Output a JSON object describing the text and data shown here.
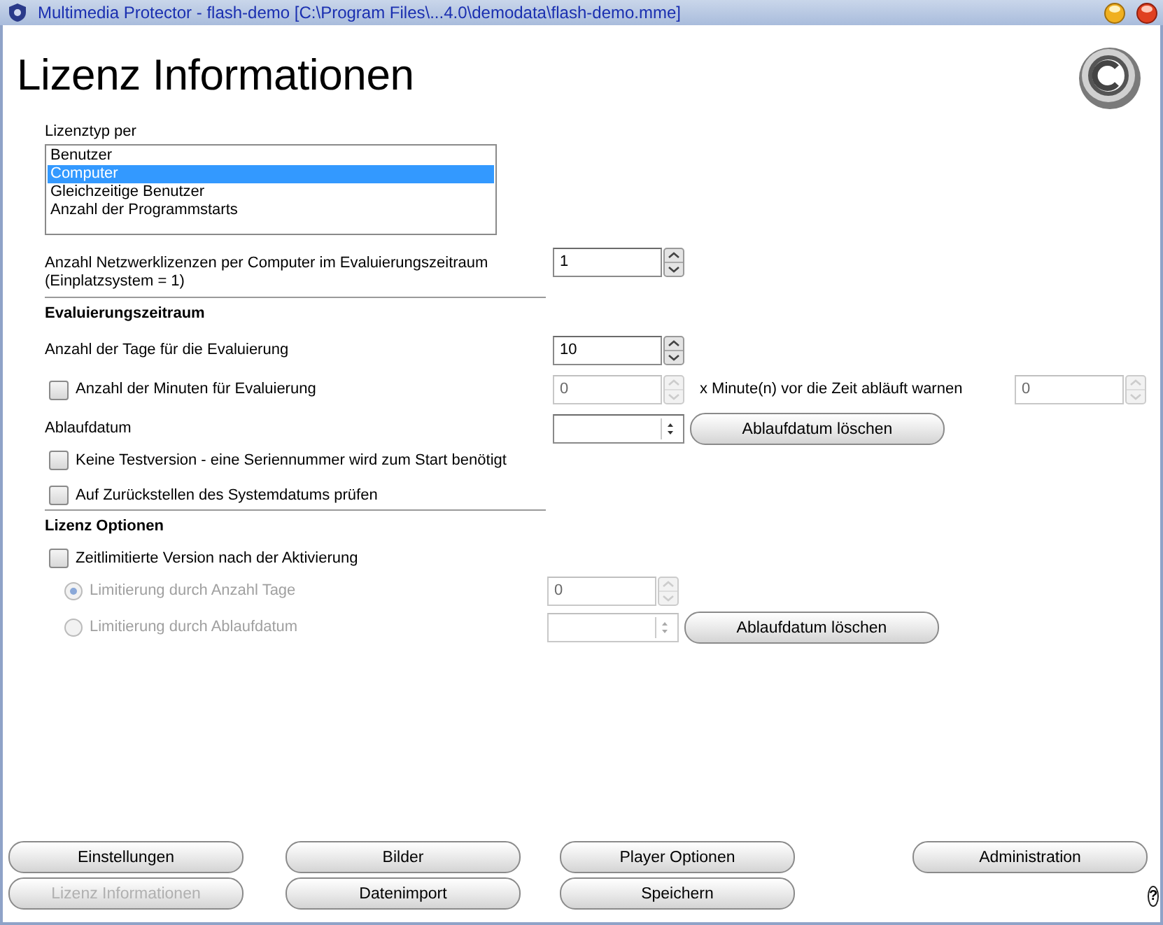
{
  "window": {
    "title": "Multimedia Protector - flash-demo [C:\\Program Files\\...4.0\\demodata\\flash-demo.mme]"
  },
  "heading": "Lizenz Informationen",
  "license_type": {
    "label": "Lizenztyp per",
    "options": [
      {
        "label": "Benutzer",
        "selected": false
      },
      {
        "label": "Computer",
        "selected": true
      },
      {
        "label": "Gleichzeitige Benutzer",
        "selected": false
      },
      {
        "label": "Anzahl der Programmstarts",
        "selected": false
      }
    ]
  },
  "network_licenses": {
    "label": "Anzahl Netzwerklizenzen per Computer im Evaluierungszeitraum\n(Einplatzsystem = 1)",
    "value": "1"
  },
  "evaluation": {
    "heading": "Evaluierungszeitraum",
    "days": {
      "label": "Anzahl der Tage für die Evaluierung",
      "value": "10"
    },
    "minutes": {
      "label": "Anzahl der Minuten für Evaluierung",
      "checked": false,
      "value": "0",
      "disabled": true,
      "warn_label": "x Minute(n) vor die Zeit abläuft warnen",
      "warn_value": "0"
    },
    "expiry": {
      "label": "Ablaufdatum",
      "clear_button": "Ablaufdatum löschen"
    },
    "no_trial": {
      "label": "Keine Testversion - eine Seriennummer wird zum Start benötigt",
      "checked": false
    },
    "check_date": {
      "label": "Auf Zurückstellen des Systemdatums prüfen",
      "checked": false
    }
  },
  "options": {
    "heading": "Lizenz Optionen",
    "time_limited": {
      "label": "Zeitlimitierte Version nach der Aktivierung",
      "checked": false
    },
    "limits": [
      {
        "kind": "days",
        "label": "Limitierung durch Anzahl Tage",
        "selected": true,
        "disabled": true,
        "value": "0"
      },
      {
        "kind": "date",
        "label": "Limitierung durch Ablaufdatum",
        "selected": false,
        "disabled": true,
        "clear_button": "Ablaufdatum löschen"
      }
    ]
  },
  "buttons": [
    [
      {
        "label": "Einstellungen",
        "disabled": false
      },
      {
        "label": "Lizenz Informationen",
        "disabled": true
      }
    ],
    [
      {
        "label": "Bilder",
        "disabled": false
      },
      {
        "label": "Datenimport",
        "disabled": false
      }
    ],
    [
      {
        "label": "Player Optionen",
        "disabled": false
      },
      {
        "label": "Speichern",
        "disabled": false
      }
    ],
    [
      {
        "label": "Administration",
        "disabled": false
      }
    ]
  ],
  "help": "?"
}
